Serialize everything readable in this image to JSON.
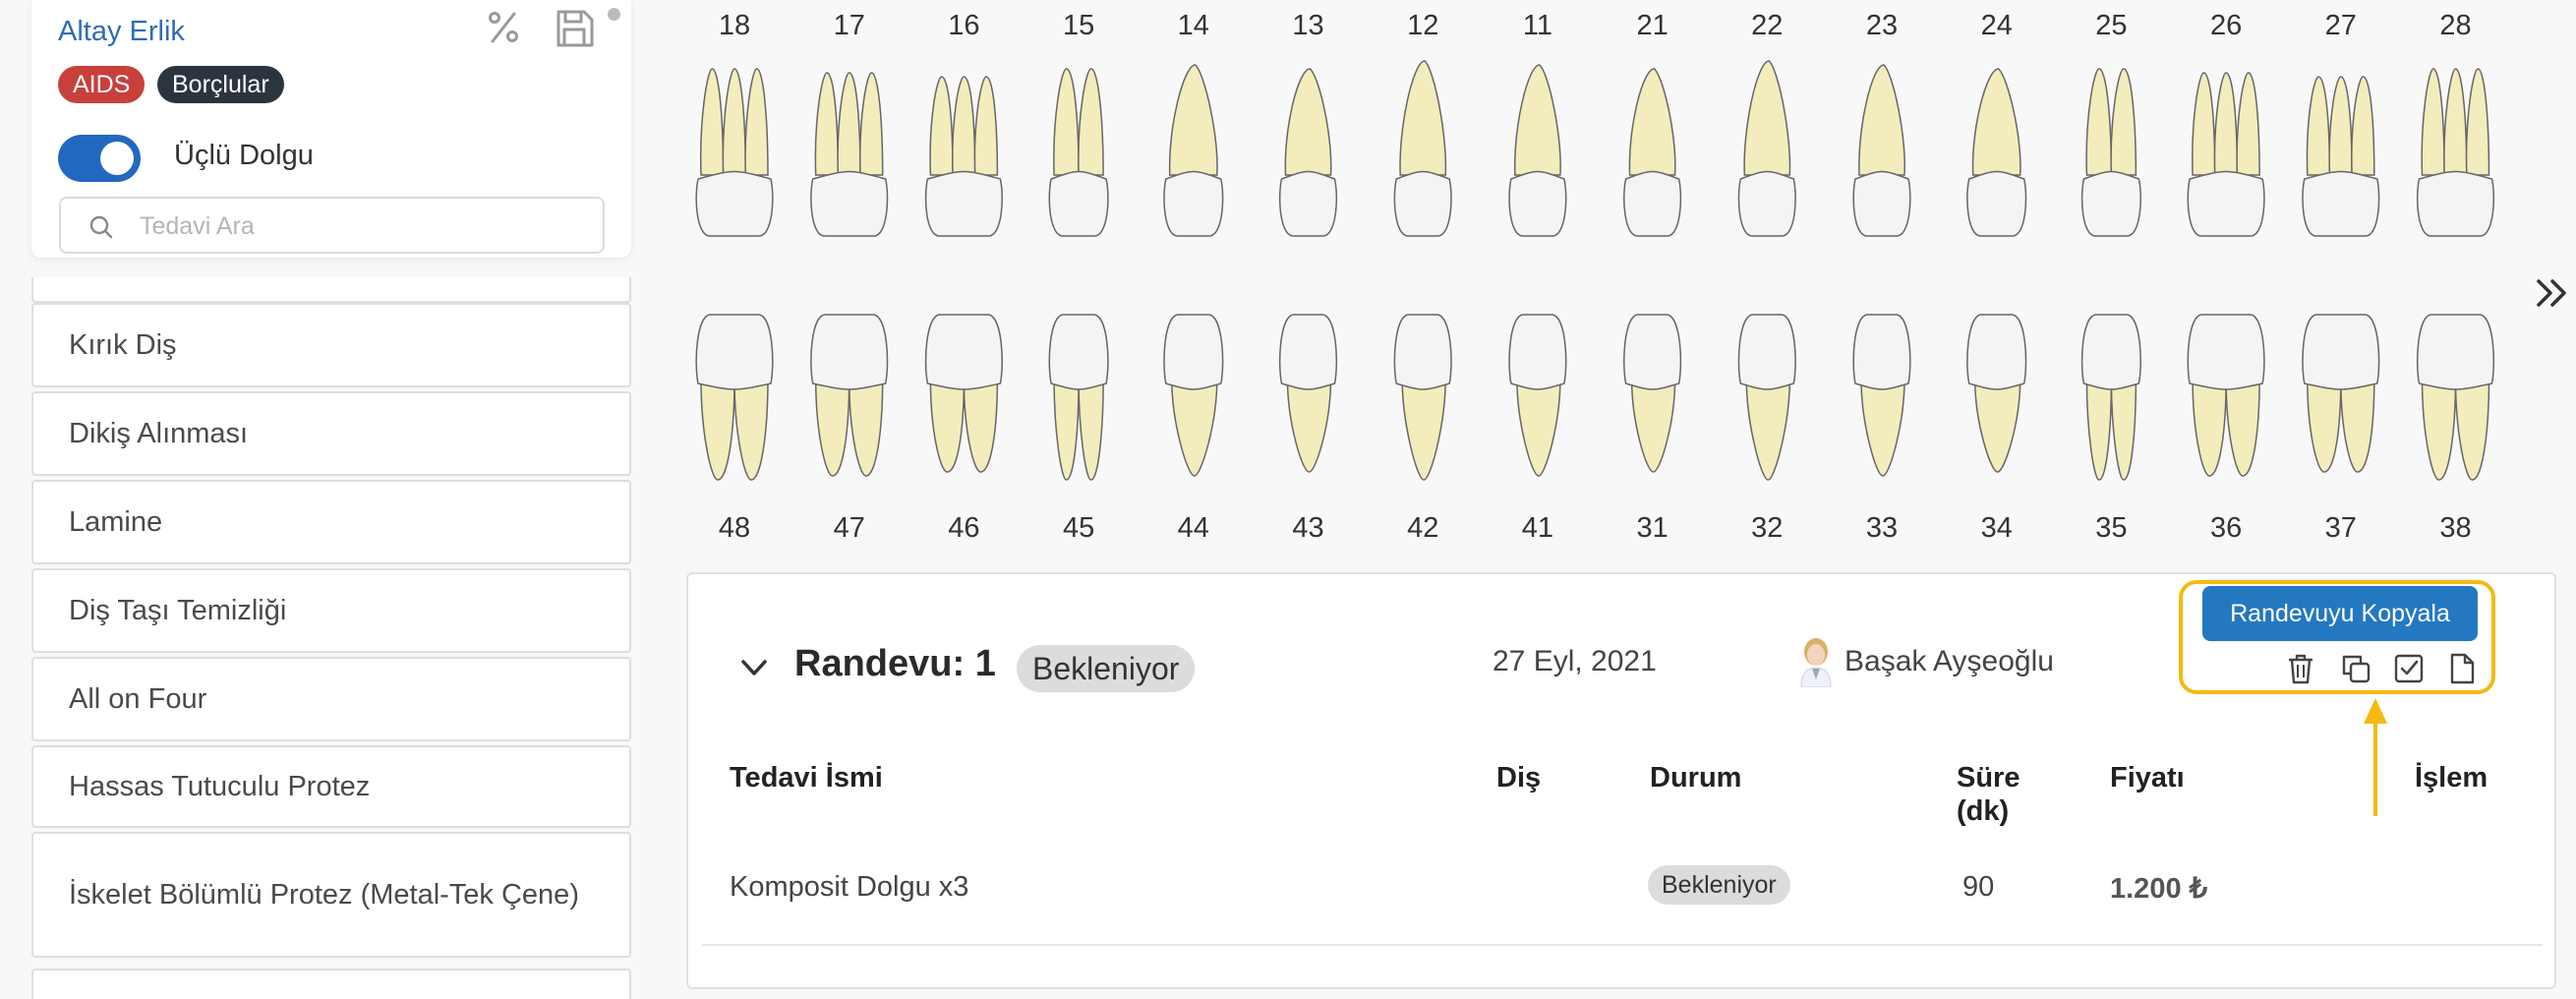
{
  "patient": {
    "name": "Altay Erlik",
    "badges": [
      "AIDS",
      "Borçlular"
    ],
    "toggle_label": "Üçlü Dolgu",
    "toggle_on": true
  },
  "search": {
    "placeholder": "Tedavi Ara"
  },
  "treatments": [
    "Kırık Diş",
    "Dikiş Alınması",
    "Lamine",
    "Diş Taşı Temizliği",
    "All on Four",
    "Hassas Tutuculu Protez",
    "İskelet Bölümlü Protez (Metal-Tek Çene)"
  ],
  "teeth": {
    "upper": [
      "18",
      "17",
      "16",
      "15",
      "14",
      "13",
      "12",
      "11",
      "21",
      "22",
      "23",
      "24",
      "25",
      "26",
      "27",
      "28"
    ],
    "lower": [
      "48",
      "47",
      "46",
      "45",
      "44",
      "43",
      "42",
      "41",
      "31",
      "32",
      "33",
      "34",
      "35",
      "36",
      "37",
      "38"
    ]
  },
  "appointment": {
    "title": "Randevu: 1",
    "status": "Bekleniyor",
    "date": "27 Eyl, 2021",
    "doctor": "Başak Ayşeoğlu",
    "copy_label": "Randevuyu Kopyala",
    "columns": {
      "name": "Tedavi İsmi",
      "tooth": "Diş",
      "status": "Durum",
      "duration_1": "Süre",
      "duration_2": "(dk)",
      "price": "Fiyatı",
      "action": "İşlem"
    },
    "rows": [
      {
        "name": "Komposit Dolgu x3",
        "tooth": "",
        "status": "Bekleniyor",
        "duration": "90",
        "price": "1.200 ₺"
      }
    ]
  },
  "colors": {
    "accent": "#2268c0",
    "highlight": "#f5b914",
    "aids_badge": "#c8403c",
    "debt_badge": "#2c3440",
    "root": "#f3ecbc",
    "crown": "#f4f4f4"
  }
}
